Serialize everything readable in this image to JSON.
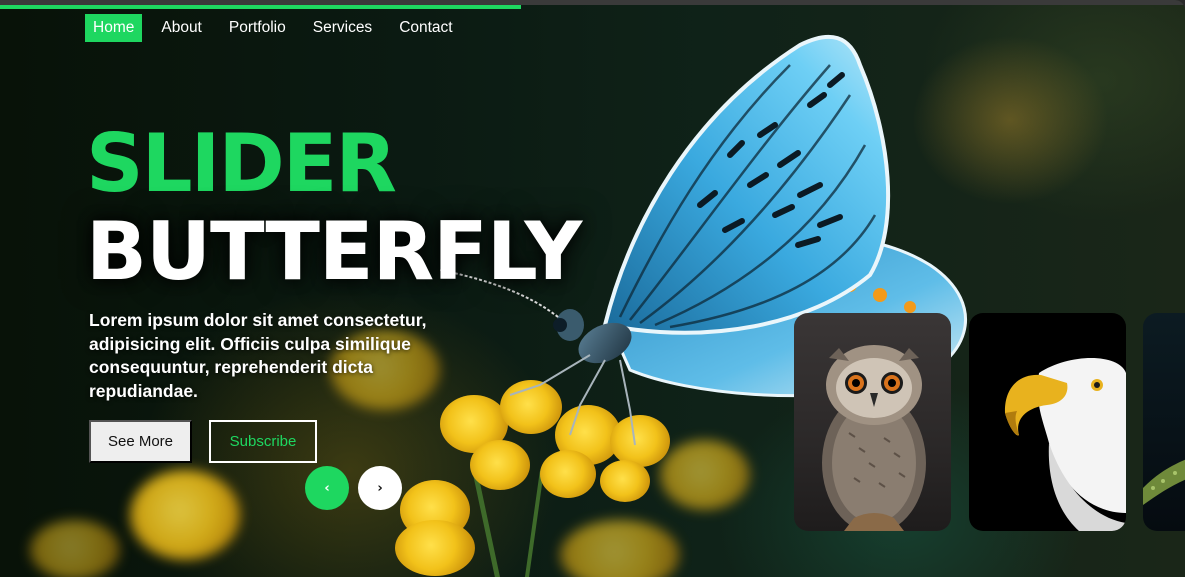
{
  "nav": {
    "items": [
      {
        "label": "Home",
        "active": true
      },
      {
        "label": "About",
        "active": false
      },
      {
        "label": "Portfolio",
        "active": false
      },
      {
        "label": "Services",
        "active": false
      },
      {
        "label": "Contact",
        "active": false
      }
    ]
  },
  "slider": {
    "progress": 0.44,
    "title_line1": "SLIDER",
    "title_line2": "BUTTERFLY",
    "description": "Lorem ipsum dolor sit amet consectetur, adipisicing elit. Officiis culpa similique consequuntur, reprehenderit dicta repudiandae.",
    "primary_button": "See More",
    "secondary_button": "Subscribe",
    "prev_arrow": "‹",
    "next_arrow": "›"
  },
  "thumbnails": [
    {
      "subject": "owl"
    },
    {
      "subject": "eagle"
    },
    {
      "subject": "branch"
    }
  ],
  "colors": {
    "accent": "#1ed760",
    "text": "#ffffff",
    "button_bg": "#eeeeee"
  },
  "icons": {
    "prev": "chevron-left-icon",
    "next": "chevron-right-icon"
  }
}
